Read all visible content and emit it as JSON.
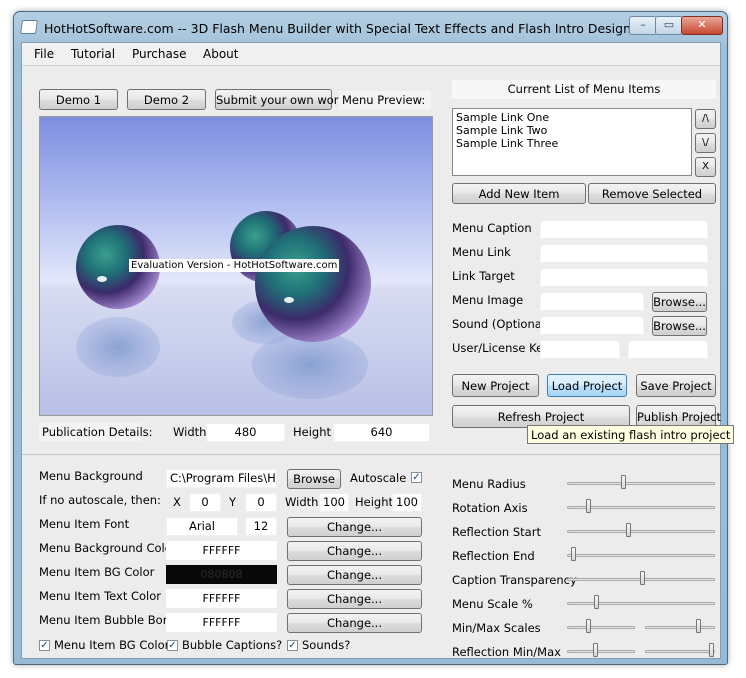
{
  "window": {
    "title": "HotHotSoftware.com -- 3D Flash Menu Builder with Special Text Effects and Flash Intro Designer",
    "minimize": "–",
    "restore": "▭",
    "close": "✕"
  },
  "menu": [
    {
      "label": "File"
    },
    {
      "label": "Tutorial"
    },
    {
      "label": "Purchase"
    },
    {
      "label": "About"
    }
  ],
  "top_buttons": {
    "demo1": "Demo 1",
    "demo2": "Demo 2",
    "submit": "Submit your own work!",
    "preview_label": "Menu Preview:"
  },
  "preview": {
    "watermark": "Evaluation Version - HotHotSoftware.com"
  },
  "publication": {
    "label": "Publication Details:",
    "width_label": "Width",
    "width": "480",
    "height_label": "Height",
    "height": "640"
  },
  "menu_items_panel": {
    "header": "Current List of Menu Items",
    "items": [
      "Sample Link One",
      "Sample Link Two",
      "Sample Link Three"
    ],
    "up": "/\\",
    "down": "\\/",
    "delete": "X",
    "add": "Add New Item",
    "remove": "Remove Selected"
  },
  "item_fields": {
    "caption": "Menu Caption",
    "link": "Menu Link",
    "target": "Link Target",
    "image": "Menu Image",
    "sound": "Sound (Optional)",
    "license": "User/License Key",
    "browse": "Browse..."
  },
  "project": {
    "new": "New Project",
    "load": "Load Project",
    "save": "Save Project",
    "refresh": "Refresh Project",
    "publish": "Publish Project",
    "tooltip": "Load an existing flash intro project"
  },
  "appearance": {
    "bg_label": "Menu Background",
    "bg_value": "C:\\Program Files\\HotH",
    "browse": "Browse",
    "autoscale": "Autoscale",
    "noscale_label": "If no autoscale, then:",
    "x_label": "X",
    "x": "0",
    "y_label": "Y",
    "y": "0",
    "w_label": "Width",
    "w": "100",
    "h_label": "Height",
    "h": "100",
    "font_label": "Menu Item Font",
    "font": "Arial",
    "font_size": "12",
    "change": "Change...",
    "bgcolor_label": "Menu Background Color",
    "bgcolor": "FFFFFF",
    "itembg_label": "Menu Item BG Color",
    "itembg": "080808",
    "textcolor_label": "Menu Item Text Color",
    "textcolor": "FFFFFF",
    "border_label": "Menu Item Bubble Border",
    "border": "FFFFFF",
    "chk_itembg": "Menu Item BG Color?",
    "chk_bubble": "Bubble Captions?",
    "chk_sounds": "Sounds?"
  },
  "sliders": [
    {
      "label": "Menu Radius",
      "value": 0.38
    },
    {
      "label": "Rotation Axis",
      "value": 0.13
    },
    {
      "label": "Reflection Start",
      "value": 0.41
    },
    {
      "label": "Reflection End",
      "value": 0.03
    },
    {
      "label": "Caption Transparency",
      "value": 0.51
    },
    {
      "label": "Menu Scale %",
      "value": 0.19
    }
  ],
  "dual_sliders": [
    {
      "label": "Min/Max Scales",
      "a": 0.3,
      "b": 0.78
    },
    {
      "label": "Reflection Min/Max",
      "a": 0.42,
      "b": 0.98
    }
  ],
  "colors": {
    "itembg_swatch": "#080808"
  }
}
